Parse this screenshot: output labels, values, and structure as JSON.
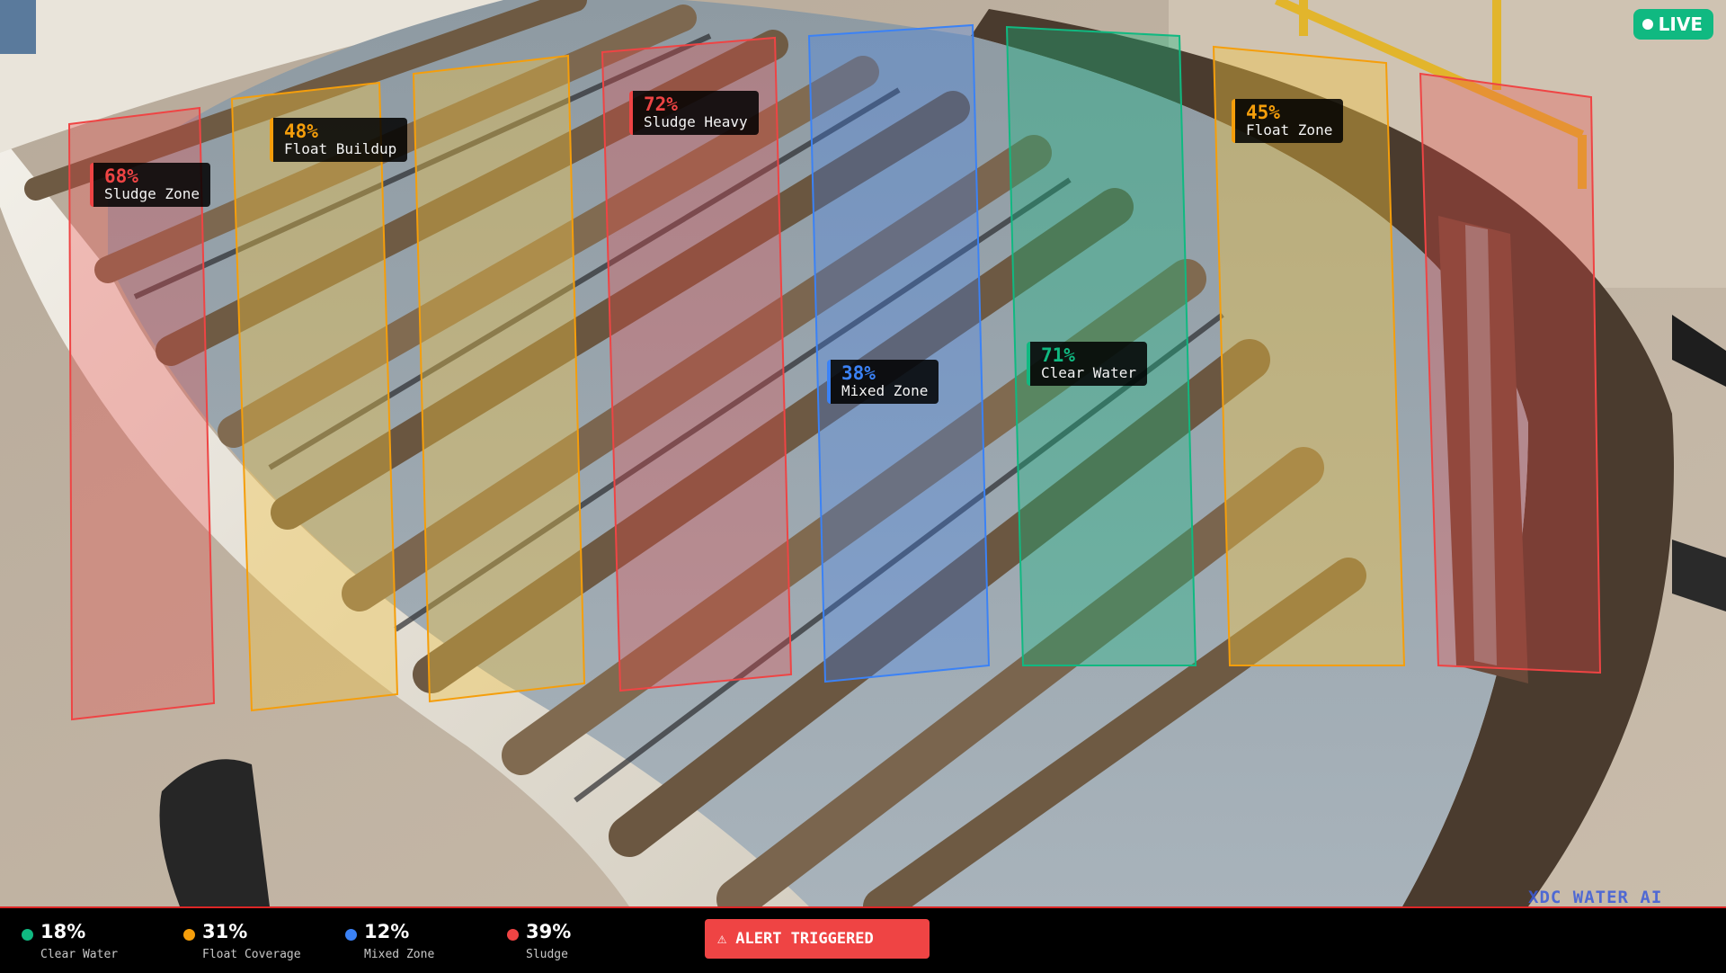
{
  "live_badge": {
    "label": "LIVE",
    "color": "#10b981"
  },
  "watermark": "XDC WATER AI",
  "zones": [
    {
      "pct": "68%",
      "name": "Sludge Zone",
      "color": "#ef4444",
      "kind": "sludge"
    },
    {
      "pct": "48%",
      "name": "Float Buildup",
      "color": "#f59e0b",
      "kind": "float"
    },
    {
      "pct": "",
      "name": "",
      "color": "#f59e0b",
      "kind": "float"
    },
    {
      "pct": "72%",
      "name": "Sludge Heavy",
      "color": "#ef4444",
      "kind": "sludge"
    },
    {
      "pct": "38%",
      "name": "Mixed Zone",
      "color": "#3b82f6",
      "kind": "mixed"
    },
    {
      "pct": "71%",
      "name": "Clear Water",
      "color": "#10b981",
      "kind": "clear"
    },
    {
      "pct": "45%",
      "name": "Float Zone",
      "color": "#f59e0b",
      "kind": "float"
    },
    {
      "pct": "",
      "name": "",
      "color": "#ef4444",
      "kind": "sludge"
    }
  ],
  "metrics": [
    {
      "value": "18%",
      "label": "Clear Water",
      "color": "#10b981"
    },
    {
      "value": "31%",
      "label": "Float Coverage",
      "color": "#f59e0b"
    },
    {
      "value": "12%",
      "label": "Mixed Zone",
      "color": "#3b82f6"
    },
    {
      "value": "39%",
      "label": "Sludge",
      "color": "#ef4444"
    }
  ],
  "alert": {
    "icon": "warning-icon",
    "text": "ALERT TRIGGERED",
    "color": "#ef4444"
  }
}
